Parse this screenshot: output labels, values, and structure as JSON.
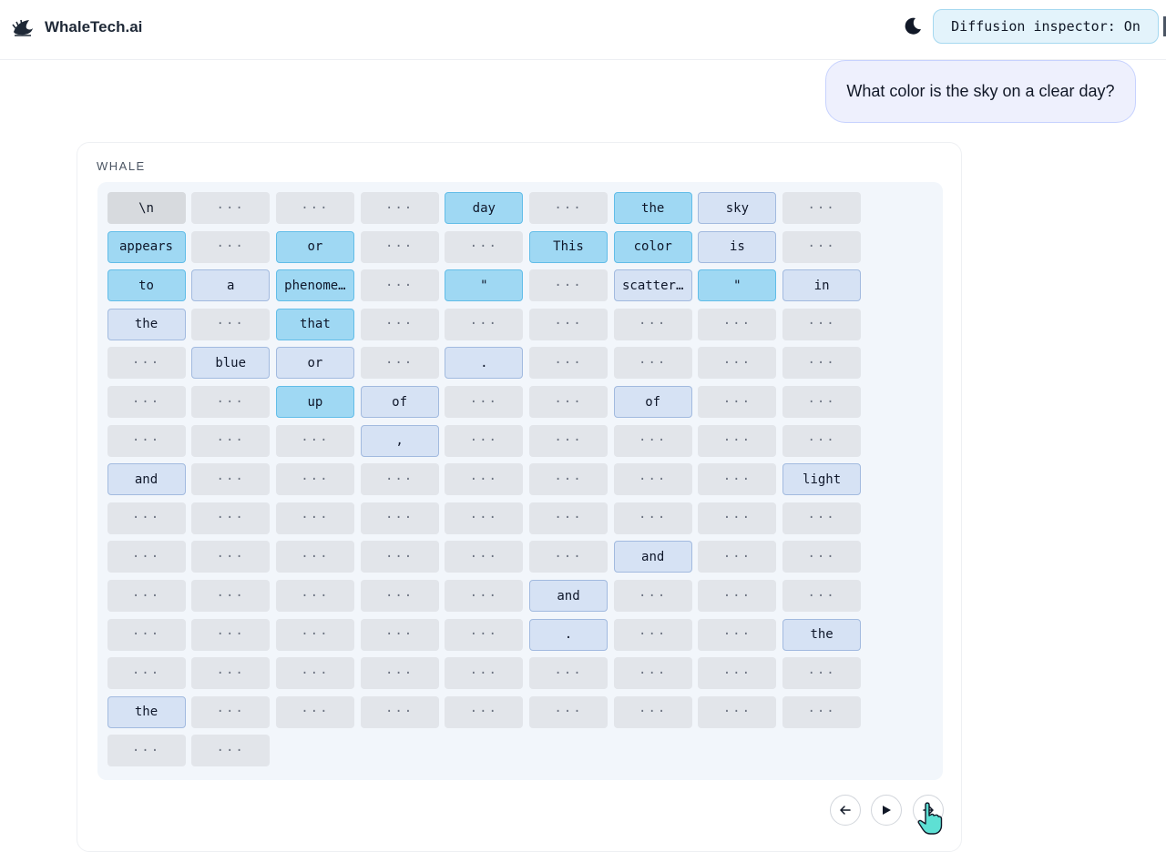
{
  "header": {
    "brand": "WhaleTech.ai",
    "logo_icon": "whale-logo-icon",
    "theme_icon": "moon-icon",
    "inspector_label": "Diffusion inspector: On"
  },
  "chat": {
    "user_message": "What color is the sky on a clear day?",
    "assistant_label": "WHALE"
  },
  "token_grid": {
    "columns": 9,
    "mask_token": "···",
    "rows": [
      [
        {
          "t": "\\n",
          "s": "start"
        },
        {
          "t": "···",
          "s": "mask"
        },
        {
          "t": "···",
          "s": "mask"
        },
        {
          "t": "···",
          "s": "mask"
        },
        {
          "t": "day",
          "s": "new"
        },
        {
          "t": "···",
          "s": "mask"
        },
        {
          "t": "the",
          "s": "new"
        },
        {
          "t": "sky",
          "s": "old"
        },
        {
          "t": "···",
          "s": "mask"
        }
      ],
      [
        {
          "t": "appears",
          "s": "new"
        },
        {
          "t": "···",
          "s": "mask"
        },
        {
          "t": "or",
          "s": "new"
        },
        {
          "t": "···",
          "s": "mask"
        },
        {
          "t": "···",
          "s": "mask"
        },
        {
          "t": "This",
          "s": "new"
        },
        {
          "t": "color",
          "s": "new"
        },
        {
          "t": "is",
          "s": "old"
        },
        {
          "t": "···",
          "s": "mask"
        }
      ],
      [
        {
          "t": "to",
          "s": "new"
        },
        {
          "t": "a",
          "s": "old"
        },
        {
          "t": "phenome…",
          "s": "new"
        },
        {
          "t": "···",
          "s": "mask"
        },
        {
          "t": "\"",
          "s": "new"
        },
        {
          "t": "···",
          "s": "mask"
        },
        {
          "t": "scatter…",
          "s": "old"
        },
        {
          "t": "\"",
          "s": "new"
        },
        {
          "t": "in",
          "s": "old"
        }
      ],
      [
        {
          "t": "the",
          "s": "old"
        },
        {
          "t": "···",
          "s": "mask"
        },
        {
          "t": "that",
          "s": "new"
        },
        {
          "t": "···",
          "s": "mask"
        },
        {
          "t": "···",
          "s": "mask"
        },
        {
          "t": "···",
          "s": "mask"
        },
        {
          "t": "···",
          "s": "mask"
        },
        {
          "t": "···",
          "s": "mask"
        },
        {
          "t": "···",
          "s": "mask"
        }
      ],
      [
        {
          "t": "···",
          "s": "mask"
        },
        {
          "t": "blue",
          "s": "old"
        },
        {
          "t": "or",
          "s": "old"
        },
        {
          "t": "···",
          "s": "mask"
        },
        {
          "t": ".",
          "s": "old"
        },
        {
          "t": "···",
          "s": "mask"
        },
        {
          "t": "···",
          "s": "mask"
        },
        {
          "t": "···",
          "s": "mask"
        },
        {
          "t": "···",
          "s": "mask"
        }
      ],
      [
        {
          "t": "···",
          "s": "mask"
        },
        {
          "t": "···",
          "s": "mask"
        },
        {
          "t": "up",
          "s": "new"
        },
        {
          "t": "of",
          "s": "old"
        },
        {
          "t": "···",
          "s": "mask"
        },
        {
          "t": "···",
          "s": "mask"
        },
        {
          "t": "of",
          "s": "old"
        },
        {
          "t": "···",
          "s": "mask"
        },
        {
          "t": "···",
          "s": "mask"
        }
      ],
      [
        {
          "t": "···",
          "s": "mask"
        },
        {
          "t": "···",
          "s": "mask"
        },
        {
          "t": "···",
          "s": "mask"
        },
        {
          "t": ",",
          "s": "old"
        },
        {
          "t": "···",
          "s": "mask"
        },
        {
          "t": "···",
          "s": "mask"
        },
        {
          "t": "···",
          "s": "mask"
        },
        {
          "t": "···",
          "s": "mask"
        },
        {
          "t": "···",
          "s": "mask"
        }
      ],
      [
        {
          "t": "and",
          "s": "old"
        },
        {
          "t": "···",
          "s": "mask"
        },
        {
          "t": "···",
          "s": "mask"
        },
        {
          "t": "···",
          "s": "mask"
        },
        {
          "t": "···",
          "s": "mask"
        },
        {
          "t": "···",
          "s": "mask"
        },
        {
          "t": "···",
          "s": "mask"
        },
        {
          "t": "···",
          "s": "mask"
        },
        {
          "t": "light",
          "s": "old"
        }
      ],
      [
        {
          "t": "···",
          "s": "mask"
        },
        {
          "t": "···",
          "s": "mask"
        },
        {
          "t": "···",
          "s": "mask"
        },
        {
          "t": "···",
          "s": "mask"
        },
        {
          "t": "···",
          "s": "mask"
        },
        {
          "t": "···",
          "s": "mask"
        },
        {
          "t": "···",
          "s": "mask"
        },
        {
          "t": "···",
          "s": "mask"
        },
        {
          "t": "···",
          "s": "mask"
        }
      ],
      [
        {
          "t": "···",
          "s": "mask"
        },
        {
          "t": "···",
          "s": "mask"
        },
        {
          "t": "···",
          "s": "mask"
        },
        {
          "t": "···",
          "s": "mask"
        },
        {
          "t": "···",
          "s": "mask"
        },
        {
          "t": "···",
          "s": "mask"
        },
        {
          "t": "and",
          "s": "old"
        },
        {
          "t": "···",
          "s": "mask"
        },
        {
          "t": "···",
          "s": "mask"
        }
      ],
      [
        {
          "t": "···",
          "s": "mask"
        },
        {
          "t": "···",
          "s": "mask"
        },
        {
          "t": "···",
          "s": "mask"
        },
        {
          "t": "···",
          "s": "mask"
        },
        {
          "t": "···",
          "s": "mask"
        },
        {
          "t": "and",
          "s": "old"
        },
        {
          "t": "···",
          "s": "mask"
        },
        {
          "t": "···",
          "s": "mask"
        },
        {
          "t": "···",
          "s": "mask"
        }
      ],
      [
        {
          "t": "···",
          "s": "mask"
        },
        {
          "t": "···",
          "s": "mask"
        },
        {
          "t": "···",
          "s": "mask"
        },
        {
          "t": "···",
          "s": "mask"
        },
        {
          "t": "···",
          "s": "mask"
        },
        {
          "t": ".",
          "s": "old"
        },
        {
          "t": "···",
          "s": "mask"
        },
        {
          "t": "···",
          "s": "mask"
        },
        {
          "t": "the",
          "s": "old"
        }
      ],
      [
        {
          "t": "···",
          "s": "mask"
        },
        {
          "t": "···",
          "s": "mask"
        },
        {
          "t": "···",
          "s": "mask"
        },
        {
          "t": "···",
          "s": "mask"
        },
        {
          "t": "···",
          "s": "mask"
        },
        {
          "t": "···",
          "s": "mask"
        },
        {
          "t": "···",
          "s": "mask"
        },
        {
          "t": "···",
          "s": "mask"
        },
        {
          "t": "···",
          "s": "mask"
        }
      ],
      [
        {
          "t": "the",
          "s": "old"
        },
        {
          "t": "···",
          "s": "mask"
        },
        {
          "t": "···",
          "s": "mask"
        },
        {
          "t": "···",
          "s": "mask"
        },
        {
          "t": "···",
          "s": "mask"
        },
        {
          "t": "···",
          "s": "mask"
        },
        {
          "t": "···",
          "s": "mask"
        },
        {
          "t": "···",
          "s": "mask"
        },
        {
          "t": "···",
          "s": "mask"
        }
      ],
      [
        {
          "t": "···",
          "s": "mask"
        },
        {
          "t": "···",
          "s": "mask"
        }
      ]
    ]
  },
  "controls": {
    "back_icon": "arrow-left-icon",
    "play_icon": "play-icon",
    "forward_icon": "arrow-right-icon"
  },
  "colors": {
    "inspector_bg": "#e3f3fb",
    "user_bubble_bg": "#eef0fd",
    "token_new": "#9fd8f3",
    "token_old": "#d6e2f4",
    "token_mask": "#e2e5ea",
    "grid_panel_bg": "#f2f6fb"
  }
}
